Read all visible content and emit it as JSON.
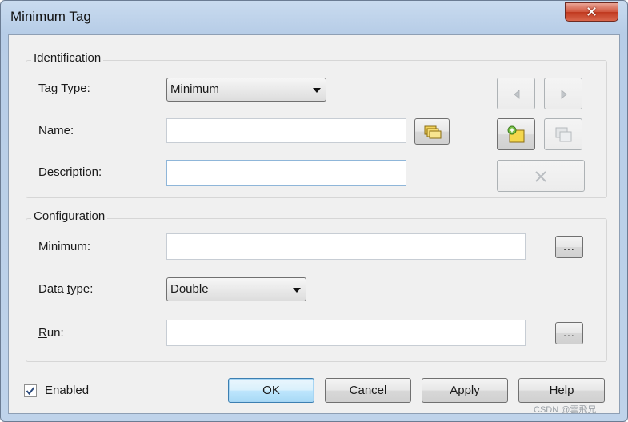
{
  "window": {
    "title": "Minimum Tag",
    "close_glyph": "✕"
  },
  "identification": {
    "group_label": "Identification",
    "tag_type_label": "Tag Type:",
    "tag_type_value": "Minimum",
    "name_label": "Name:",
    "name_value": "",
    "description_label": "Description:",
    "description_value": ""
  },
  "configuration": {
    "group_label": "Configuration",
    "minimum_label": "Minimum:",
    "minimum_value": "",
    "data_type_label_pre": "Data ",
    "data_type_label_u": "t",
    "data_type_label_post": "ype:",
    "data_type_value": "Double",
    "run_label_u": "R",
    "run_label_post": "un:",
    "run_value": "",
    "browse_label": "..."
  },
  "footer": {
    "enabled_label": "Enabled",
    "enabled_checked": true,
    "ok_label": "OK",
    "cancel_label": "Cancel",
    "apply_label": "Apply",
    "help_label": "Help"
  },
  "icons": {
    "prev": "triangle-left-icon",
    "next": "triangle-right-icon",
    "new_tag": "new-tag-icon",
    "copy_tag": "copy-tag-icon",
    "delete": "delete-x-icon",
    "tag_browser": "tag-browser-icon"
  },
  "watermark": "CSDN @雲飛兄",
  "colors": {
    "default_button_border": "#3c7fb1",
    "title_bar": "#c9dbef",
    "close_button": "#c0391f"
  }
}
